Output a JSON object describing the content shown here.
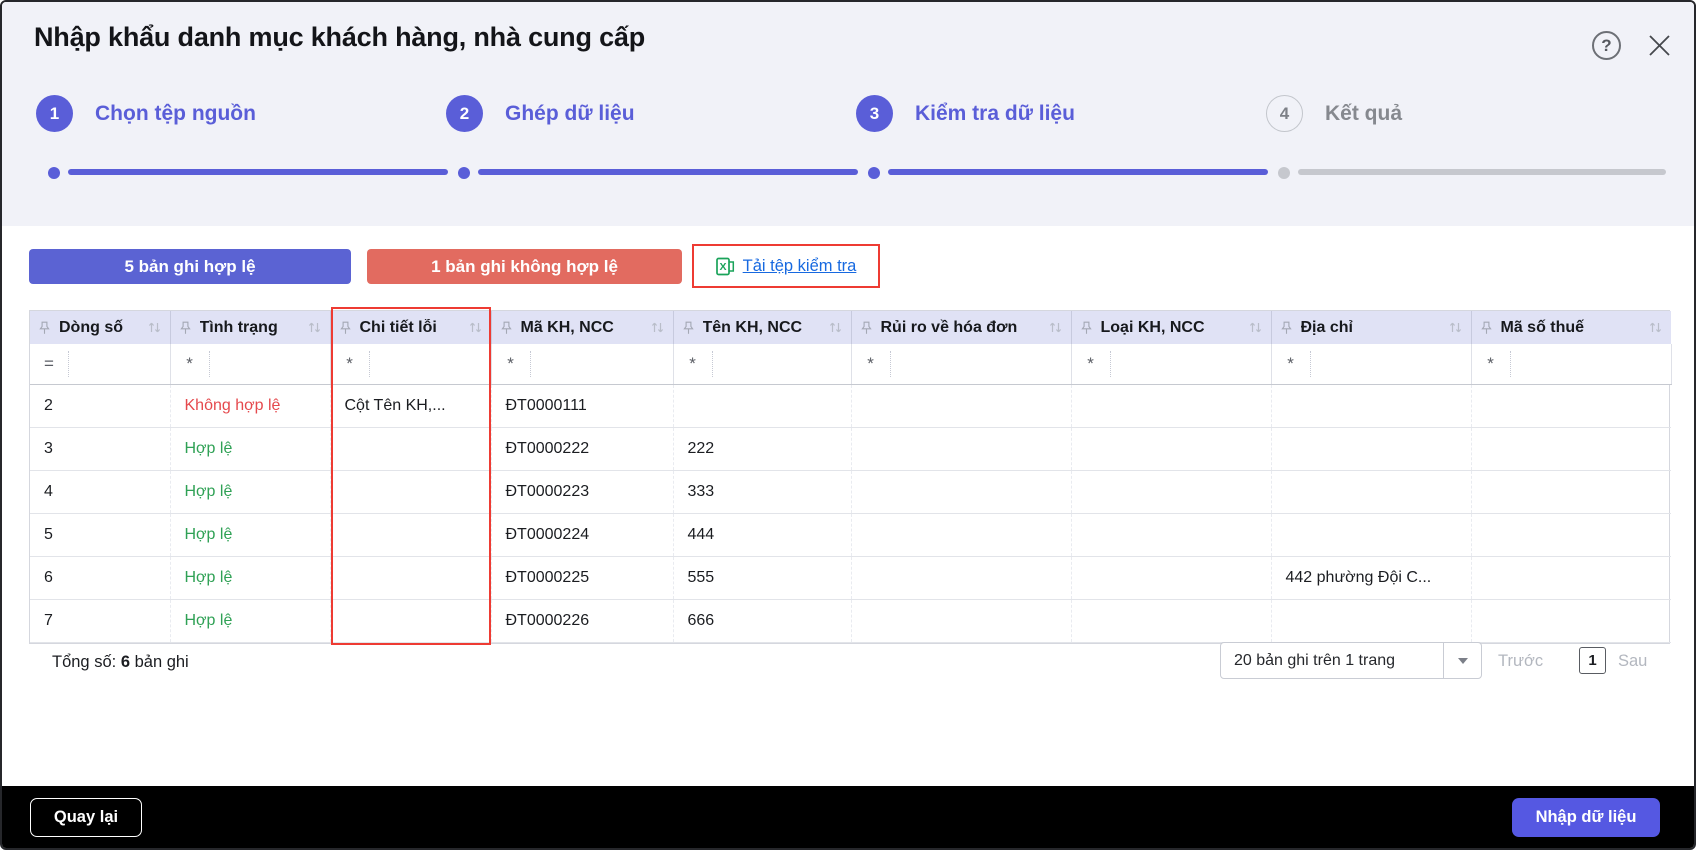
{
  "window": {
    "title": "Nhập khẩu danh mục khách hàng, nhà cung cấp",
    "help_glyph": "?"
  },
  "stepper": {
    "steps": [
      {
        "num": "1",
        "label": "Chọn tệp nguồn",
        "state": "active"
      },
      {
        "num": "2",
        "label": "Ghép dữ liệu",
        "state": "active"
      },
      {
        "num": "3",
        "label": "Kiểm tra dữ liệu",
        "state": "active"
      },
      {
        "num": "4",
        "label": "Kết quả",
        "state": "pending"
      }
    ]
  },
  "summary": {
    "valid_badge": "5 bản ghi hợp lệ",
    "invalid_badge": "1 bản ghi không hợp lệ",
    "download_link": "Tải tệp kiểm tra"
  },
  "table": {
    "columns": [
      {
        "key": "dong-so",
        "label": "Dòng số",
        "filter_op": "="
      },
      {
        "key": "tinh-trang",
        "label": "Tình trạng",
        "filter_op": "*"
      },
      {
        "key": "chi-tiet-loi",
        "label": "Chi tiết lỗi",
        "filter_op": "*"
      },
      {
        "key": "ma-kh-ncc",
        "label": "Mã KH, NCC",
        "filter_op": "*"
      },
      {
        "key": "ten-kh-ncc",
        "label": "Tên KH, NCC",
        "filter_op": "*"
      },
      {
        "key": "rui-ro-hoa-don",
        "label": "Rủi ro về hóa đơn",
        "filter_op": "*"
      },
      {
        "key": "loai-kh-ncc",
        "label": "Loại KH, NCC",
        "filter_op": "*"
      },
      {
        "key": "dia-chi",
        "label": "Địa chỉ",
        "filter_op": "*"
      },
      {
        "key": "ma-so-thue",
        "label": "Mã số thuế",
        "filter_op": "*"
      }
    ],
    "rows": [
      {
        "status": "invalid",
        "cells": [
          "2",
          "Không hợp lệ",
          "Cột Tên KH,...",
          "ĐT0000111",
          "",
          "",
          "",
          "",
          ""
        ]
      },
      {
        "status": "valid",
        "cells": [
          "3",
          "Hợp lệ",
          "",
          "ĐT0000222",
          "222",
          "",
          "",
          "",
          ""
        ]
      },
      {
        "status": "valid",
        "cells": [
          "4",
          "Hợp lệ",
          "",
          "ĐT0000223",
          "333",
          "",
          "",
          "",
          ""
        ]
      },
      {
        "status": "valid",
        "cells": [
          "5",
          "Hợp lệ",
          "",
          "ĐT0000224",
          "444",
          "",
          "",
          "",
          ""
        ]
      },
      {
        "status": "valid",
        "cells": [
          "6",
          "Hợp lệ",
          "",
          "ĐT0000225",
          "555",
          "",
          "",
          "442 phường Đội C...",
          ""
        ]
      },
      {
        "status": "valid",
        "cells": [
          "7",
          "Hợp lệ",
          "",
          "ĐT0000226",
          "666",
          "",
          "",
          "",
          ""
        ]
      }
    ]
  },
  "footer": {
    "total_prefix": "Tổng số:",
    "total_count": "6",
    "total_suffix": "bản ghi",
    "page_size_label": "20 bản ghi trên 1 trang",
    "prev_label": "Trước",
    "current_page": "1",
    "next_label": "Sau"
  },
  "actions": {
    "back_label": "Quay lại",
    "import_label": "Nhập dữ liệu"
  },
  "colors": {
    "accent_purple": "#5a5ed8",
    "badge_valid": "#5b63d3",
    "badge_invalid": "#e26b60",
    "highlight_red": "#ee3b33",
    "status_valid_text": "#2fa155",
    "status_invalid_text": "#e5494d",
    "link_blue": "#1769e0",
    "excel_green": "#1aa35a",
    "header_bg": "#e0e2f5",
    "top_section_bg": "#f1f2f8",
    "action_bar_bg": "#000000"
  }
}
